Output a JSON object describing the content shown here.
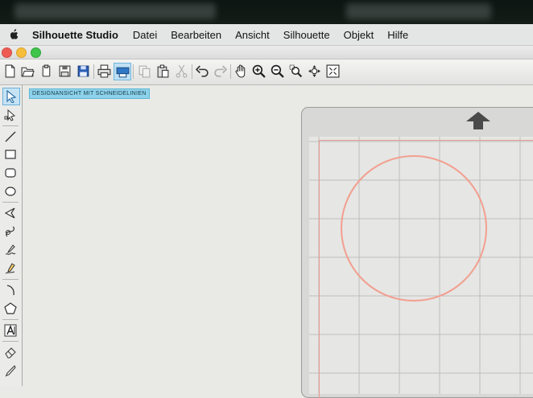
{
  "menubar": {
    "app_name": "Silhouette Studio",
    "items": [
      "Datei",
      "Bearbeiten",
      "Ansicht",
      "Silhouette",
      "Objekt",
      "Hilfe"
    ]
  },
  "window": {
    "traffic_lights": [
      "close",
      "minimize",
      "maximize"
    ]
  },
  "toolbar": {
    "buttons": [
      {
        "icon": "new-document-icon"
      },
      {
        "icon": "open-folder-icon"
      },
      {
        "icon": "library-icon"
      },
      {
        "icon": "save-icon"
      },
      {
        "icon": "save-to-library-icon"
      },
      {
        "icon": "print-icon"
      },
      {
        "icon": "send-to-silhouette-icon",
        "active": true
      },
      {
        "icon": "copy-icon",
        "disabled": true
      },
      {
        "icon": "paste-icon"
      },
      {
        "icon": "cut-icon",
        "disabled": true
      },
      {
        "icon": "undo-icon"
      },
      {
        "icon": "redo-icon",
        "disabled": true
      },
      {
        "icon": "pan-hand-icon"
      },
      {
        "icon": "zoom-in-icon"
      },
      {
        "icon": "zoom-out-icon"
      },
      {
        "icon": "zoom-selection-icon"
      },
      {
        "icon": "drag-zoom-icon"
      },
      {
        "icon": "fit-to-page-icon"
      }
    ]
  },
  "left_toolbar": {
    "tools": [
      "select-arrow-icon",
      "point-edit-icon",
      "line-icon",
      "rectangle-icon",
      "rounded-rectangle-icon",
      "ellipse-icon",
      "polygon-icon",
      "curve-icon",
      "freehand-icon",
      "smooth-freehand-icon",
      "arc-icon",
      "regular-polygon-icon",
      "text-icon",
      "eraser-icon",
      "knife-icon"
    ]
  },
  "canvas": {
    "mode_label": "DESIGNANSICHT MIT SCHNEIDELINIEN",
    "mat_arrow_icon": "feed-direction-arrow-icon",
    "shape": "circle",
    "colors": {
      "mode_label_bg": "#8dd2ea",
      "cut_line": "#f29f8f",
      "mat": "#d8d8d6",
      "grid": "#bdbdbb"
    }
  }
}
